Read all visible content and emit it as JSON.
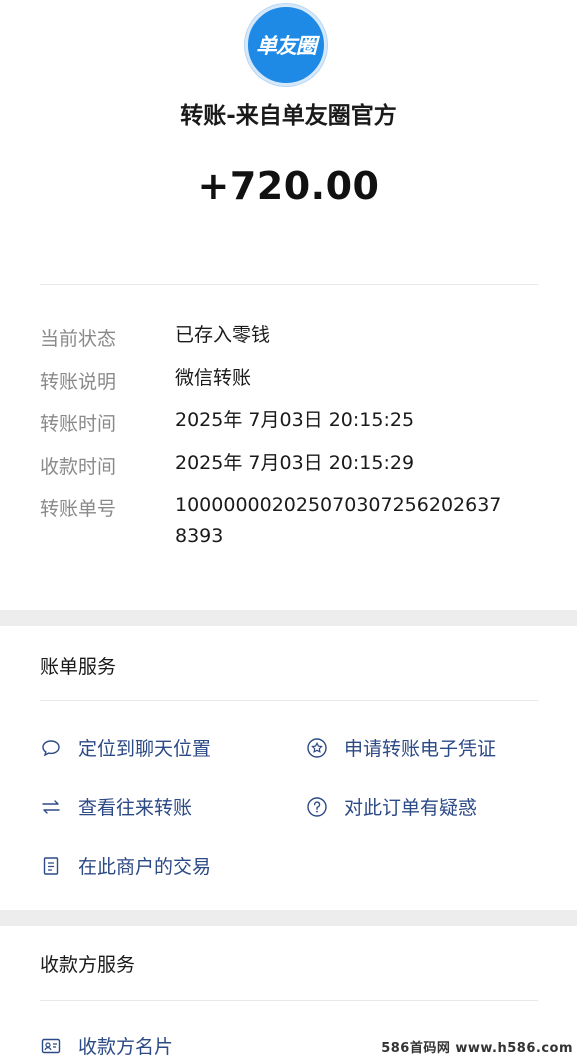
{
  "header": {
    "avatar_text": "单友圈",
    "payer_title": "转账-来自单友圈官方",
    "amount": "+720.00"
  },
  "details": [
    {
      "label": "当前状态",
      "value": "已存入零钱"
    },
    {
      "label": "转账说明",
      "value": "微信转账"
    },
    {
      "label": "转账时间",
      "value": "2025年 7月03日 20:15:25"
    },
    {
      "label": "收款时间",
      "value": "2025年 7月03日 20:15:29"
    },
    {
      "label": "转账单号",
      "value": "10000000202507030725620263783 93"
    }
  ],
  "transfer_number": {
    "line1": "100000002025070307256202637",
    "line2": "8393"
  },
  "bill_services": {
    "title": "账单服务",
    "items": [
      {
        "label": "定位到聊天位置",
        "icon": "chat-bubble-icon"
      },
      {
        "label": "申请转账电子凭证",
        "icon": "star-badge-icon"
      },
      {
        "label": "查看往来转账",
        "icon": "swap-arrows-icon"
      },
      {
        "label": "对此订单有疑惑",
        "icon": "question-icon"
      },
      {
        "label": "在此商户的交易",
        "icon": "document-icon"
      }
    ]
  },
  "payee_services": {
    "title": "收款方服务",
    "items": [
      {
        "label": "收款方名片",
        "icon": "contact-card-icon"
      }
    ]
  },
  "watermark": "586首码网 www.h586.com",
  "colors": {
    "link": "#2c4a86",
    "avatar_bg": "#1e8ae6",
    "page_bg": "#ededed"
  }
}
